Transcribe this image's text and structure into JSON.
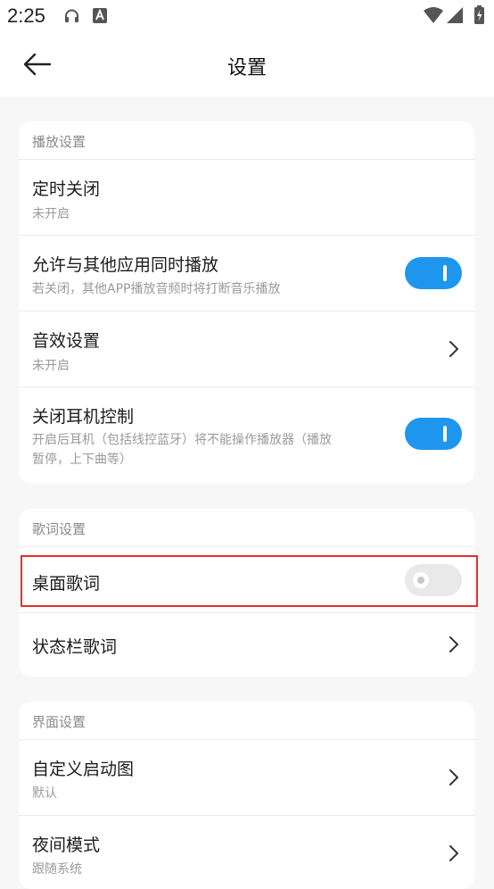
{
  "status_bar": {
    "time": "2:25"
  },
  "header": {
    "title": "设置"
  },
  "sections": [
    {
      "title": "播放设置",
      "items": [
        {
          "title": "定时关闭",
          "subtitle": "未开启",
          "control": "none"
        },
        {
          "title": "允许与其他应用同时播放",
          "subtitle": "若关闭，其他APP播放音频时将打断音乐播放",
          "control": "toggle",
          "toggle_on": true
        },
        {
          "title": "音效设置",
          "subtitle": "未开启",
          "control": "chevron"
        },
        {
          "title": "关闭耳机控制",
          "subtitle_line1": "开启后耳机（包括线控蓝牙）将不能操作播放器（播放",
          "subtitle_line2": "暂停，上下曲等）",
          "control": "toggle",
          "toggle_on": true
        }
      ]
    },
    {
      "title": "歌词设置",
      "items": [
        {
          "title": "桌面歌词",
          "control": "toggle",
          "toggle_on": false
        },
        {
          "title": "状态栏歌词",
          "control": "chevron"
        }
      ]
    },
    {
      "title": "界面设置",
      "items": [
        {
          "title": "自定义启动图",
          "subtitle": "默认",
          "control": "chevron"
        },
        {
          "title": "夜间模式",
          "subtitle": "跟随系统",
          "control": "chevron"
        }
      ]
    }
  ],
  "colors": {
    "toggle_on": "#1e96ee",
    "toggle_off": "#e9e9e9",
    "highlight": "#e0302a"
  },
  "icons": [
    "headphones-icon",
    "keyboard-a-icon",
    "wifi-icon",
    "signal-icon",
    "battery-charging-icon",
    "back-arrow-icon",
    "chevron-right-icon"
  ]
}
